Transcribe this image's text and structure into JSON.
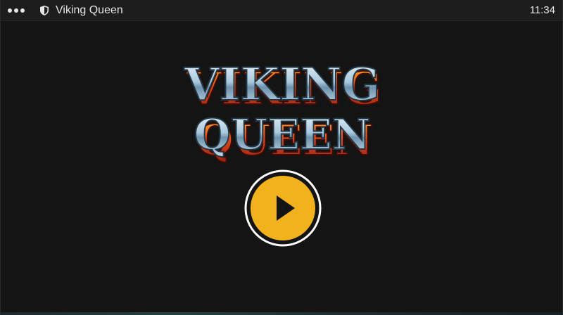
{
  "window": {
    "title": "Viking Queen",
    "clock": "11:34",
    "menu_icon": "kebab-dots-icon",
    "security_icon": "shield-icon"
  },
  "game": {
    "logo_line1": "VIKING",
    "logo_line2": "QUEEN",
    "play_icon": "play-icon"
  },
  "colors": {
    "background": "#141414",
    "titlebar": "#1d1d1d",
    "play_fill": "#f2b21c",
    "play_ring": "#ffffff",
    "logo_steel": "#b9d3e6",
    "logo_fire": "#e0451c"
  }
}
